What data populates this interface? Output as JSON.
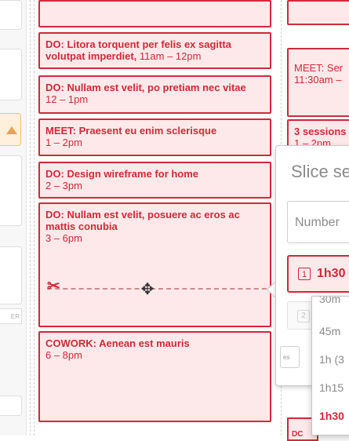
{
  "day_cards": [
    {
      "bold": "",
      "time": ""
    },
    {
      "bold": "DO: Litora torquent per felis ex sagitta volutpat imperdiet,",
      "time": " 11am – 12pm"
    },
    {
      "bold": "DO: Nullam est velit, po pretiam nec vitae",
      "time": "12 – 1pm"
    },
    {
      "bold": "MEET: Praesent eu enim sclerisque",
      "time": "1 – 2pm"
    },
    {
      "bold": "DO: Design wireframe for home",
      "time": "2 – 3pm"
    },
    {
      "bold": "DO: Nullam est velit, posuere ac eros ac mattis conubia",
      "time": "3 – 6pm"
    },
    {
      "bold": "COWORK: Aenean est mauris",
      "time": "6 – 8pm"
    }
  ],
  "right_cards": [
    {
      "bold": "MEET: Ser",
      "time": "11:30am –"
    },
    {
      "bold": "3 sessions",
      "time": "1 – 2pm"
    }
  ],
  "right_bottom_label": "DC",
  "left_edge_label": "ER",
  "popover": {
    "title": "Slice se",
    "input_placeholder": "Number",
    "selected_index": "1",
    "selected_label": "1h30",
    "row2_index": "2",
    "button_label": "es"
  },
  "dropdown": {
    "items": [
      "30m",
      "45m",
      "1h (3",
      "1h15",
      "1h30"
    ],
    "selected": "1h30"
  },
  "colors": {
    "accent": "#d1293a",
    "card_bg": "#fde9e9",
    "highlight_bg": "#fdf1dc",
    "highlight_border": "#e9a54a"
  },
  "icons": [
    "scissors-icon",
    "move-cursor-icon",
    "warning-triangle-icon"
  ]
}
